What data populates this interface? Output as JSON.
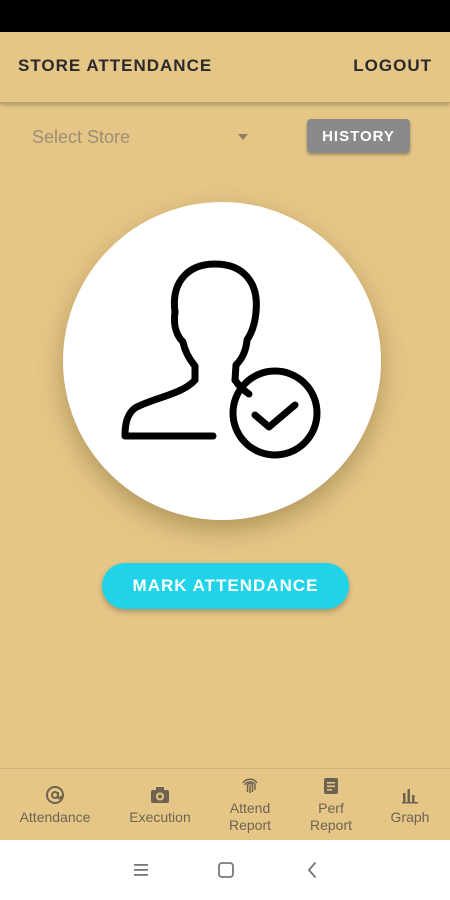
{
  "app_bar": {
    "title": "STORE ATTENDANCE",
    "logout_label": "LOGOUT"
  },
  "store_select": {
    "placeholder": "Select Store"
  },
  "history_label": "HISTORY",
  "mark_attendance_label": "MARK ATTENDANCE",
  "bottom_nav": {
    "items": [
      {
        "line1": "Attendance",
        "line2": "",
        "icon": "at-icon"
      },
      {
        "line1": "Execution",
        "line2": "",
        "icon": "camera-icon"
      },
      {
        "line1": "Attend",
        "line2": "Report",
        "icon": "fingerprint-icon"
      },
      {
        "line1": "Perf",
        "line2": "Report",
        "icon": "document-icon"
      },
      {
        "line1": "Graph",
        "line2": "",
        "icon": "bar-chart-icon"
      }
    ]
  },
  "colors": {
    "background": "#e6c687",
    "history_button": "#8a8a8a",
    "mark_button": "#20d3e8",
    "status_bar": "#000000"
  },
  "system_nav": {
    "icons": [
      "recents-icon",
      "home-icon",
      "back-icon"
    ]
  }
}
